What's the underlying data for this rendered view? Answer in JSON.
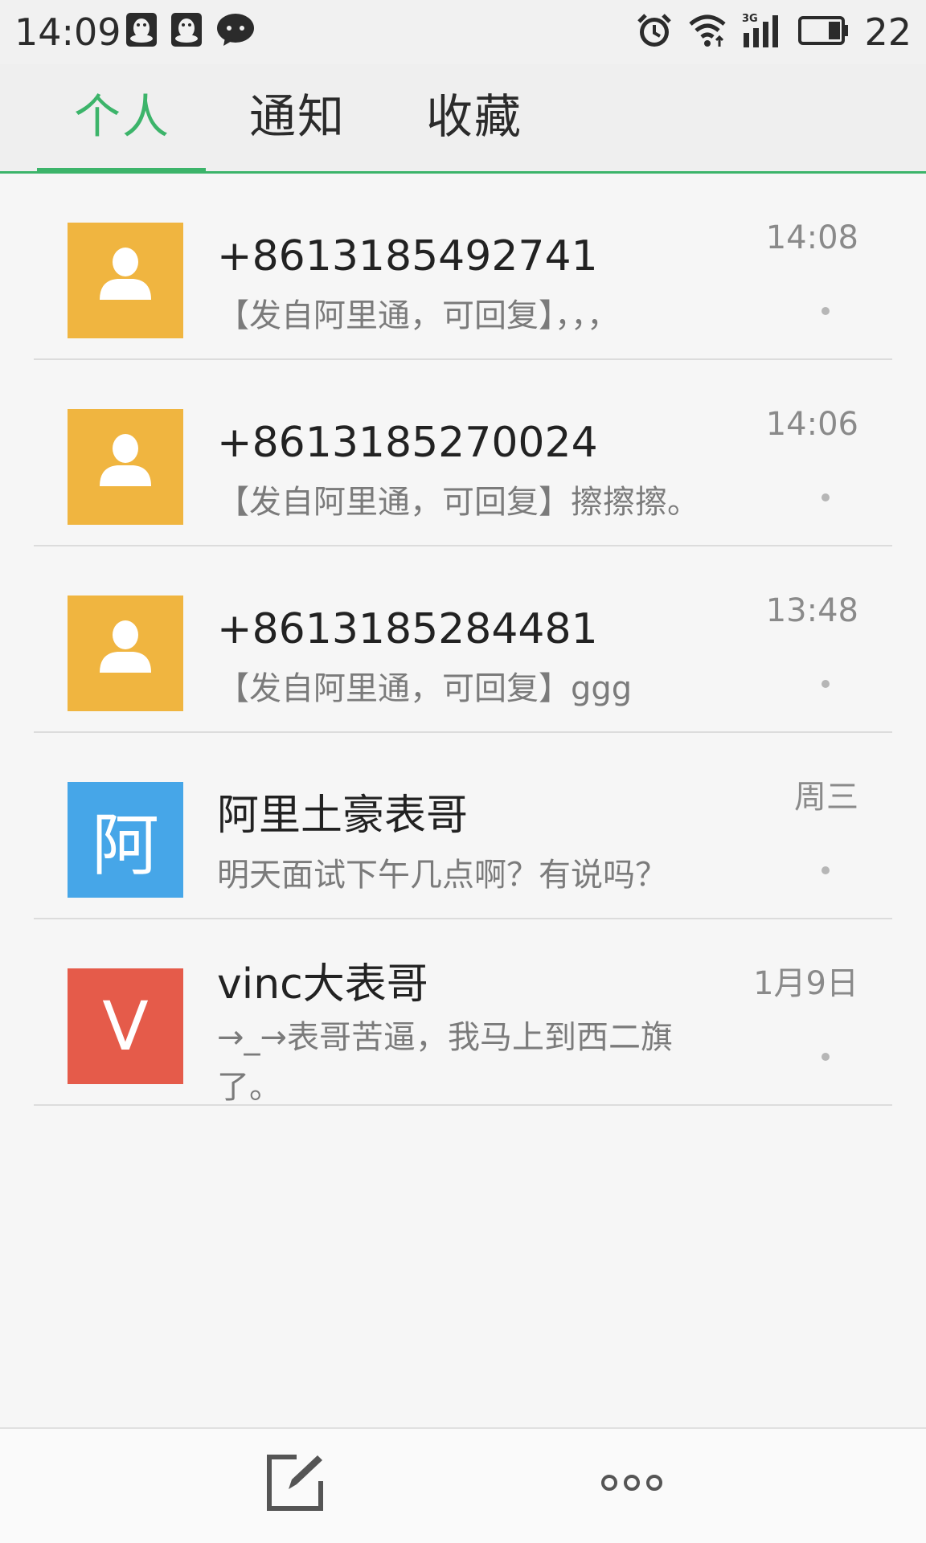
{
  "status_bar": {
    "time": "14:09",
    "battery_level": "22",
    "icons": [
      "qq-icon",
      "qq-icon",
      "wechat-icon",
      "alarm-icon",
      "wifi-icon",
      "signal-3g-icon",
      "battery-icon"
    ]
  },
  "tabs": [
    {
      "label": "个人",
      "active": true
    },
    {
      "label": "通知",
      "active": false
    },
    {
      "label": "收藏",
      "active": false
    }
  ],
  "messages": [
    {
      "name": "+8613185492741",
      "preview": "【发自阿里通，可回复】，，，",
      "time": "14:08",
      "avatar": {
        "type": "icon",
        "icon": "person-icon",
        "color": "#f0b540"
      }
    },
    {
      "name": "+8613185270024",
      "preview": "【发自阿里通，可回复】擦擦擦。",
      "time": "14:06",
      "avatar": {
        "type": "icon",
        "icon": "person-icon",
        "color": "#f0b540"
      }
    },
    {
      "name": "+8613185284481",
      "preview": "【发自阿里通，可回复】ggg",
      "time": "13:48",
      "avatar": {
        "type": "icon",
        "icon": "person-icon",
        "color": "#f0b540"
      }
    },
    {
      "name": "阿里土豪表哥",
      "preview": "明天面试下午几点啊？有说吗？",
      "time": "周三",
      "avatar": {
        "type": "letter",
        "letter": "阿",
        "color": "#46a6e8"
      }
    },
    {
      "name": "vinc大表哥",
      "preview": "→_→表哥苦逼，我马上到西二旗了。",
      "time": "1月9日",
      "avatar": {
        "type": "letter",
        "letter": "V",
        "color": "#e55b4a"
      }
    }
  ],
  "bottom_bar": {
    "compose_icon": "compose-icon",
    "more_icon": "more-icon"
  },
  "colors": {
    "accent": "#3cb46a",
    "background": "#f6f6f6"
  }
}
